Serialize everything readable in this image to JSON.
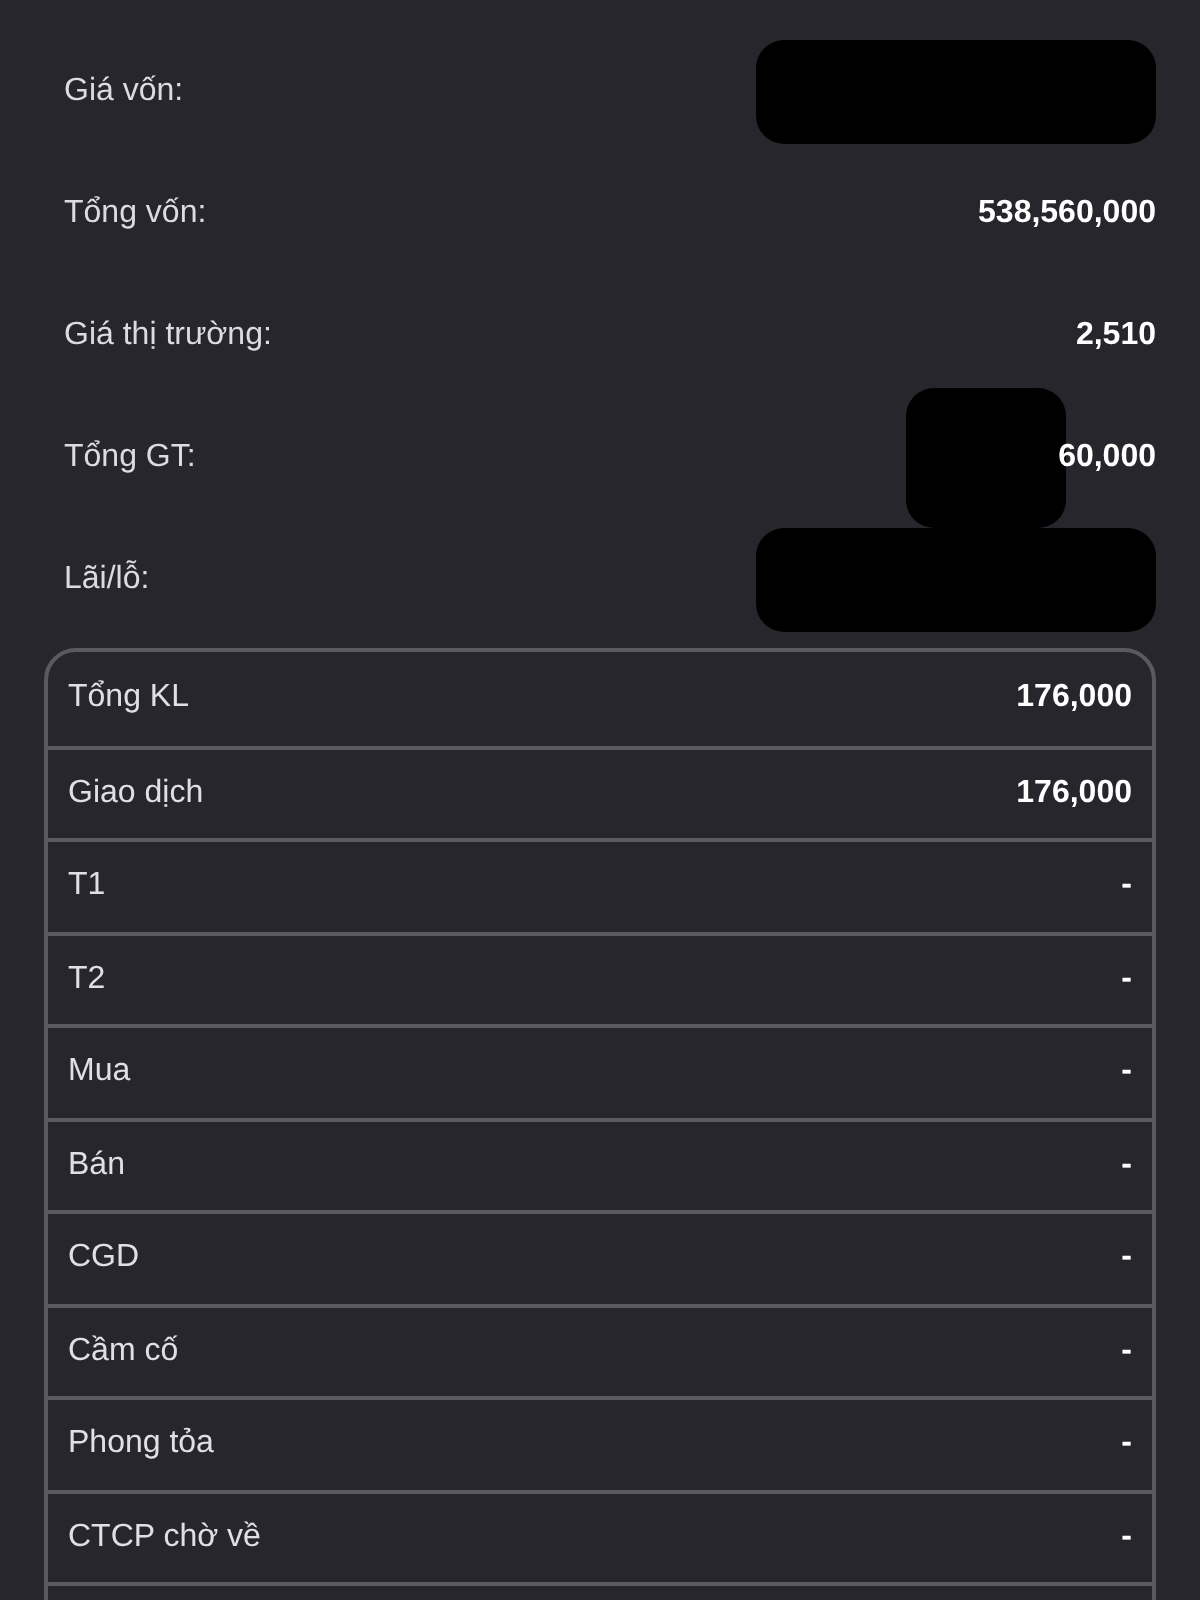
{
  "summary": [
    {
      "label": "Giá vốn:",
      "redacted": true
    },
    {
      "label": "Tổng vốn:",
      "value": "538,560,000",
      "redacted": false
    },
    {
      "label": "Giá thị trường:",
      "value": "2,510",
      "redacted": false
    },
    {
      "label": "Tổng GT:",
      "value": "60,000",
      "redacted": true
    },
    {
      "label": "Lãi/lỗ:",
      "redacted": true
    }
  ],
  "table": {
    "rows": [
      {
        "label": "Tổng KL",
        "value": "176,000"
      },
      {
        "label": "Giao dịch",
        "value": "176,000"
      },
      {
        "label": "T1",
        "value": "-"
      },
      {
        "label": "T2",
        "value": "-"
      },
      {
        "label": "Mua",
        "value": "-"
      },
      {
        "label": "Bán",
        "value": "-"
      },
      {
        "label": "CGD",
        "value": "-"
      },
      {
        "label": "Cầm cố",
        "value": "-"
      },
      {
        "label": "Phong tỏa",
        "value": "-"
      },
      {
        "label": "CTCP chờ về",
        "value": "-"
      }
    ]
  }
}
